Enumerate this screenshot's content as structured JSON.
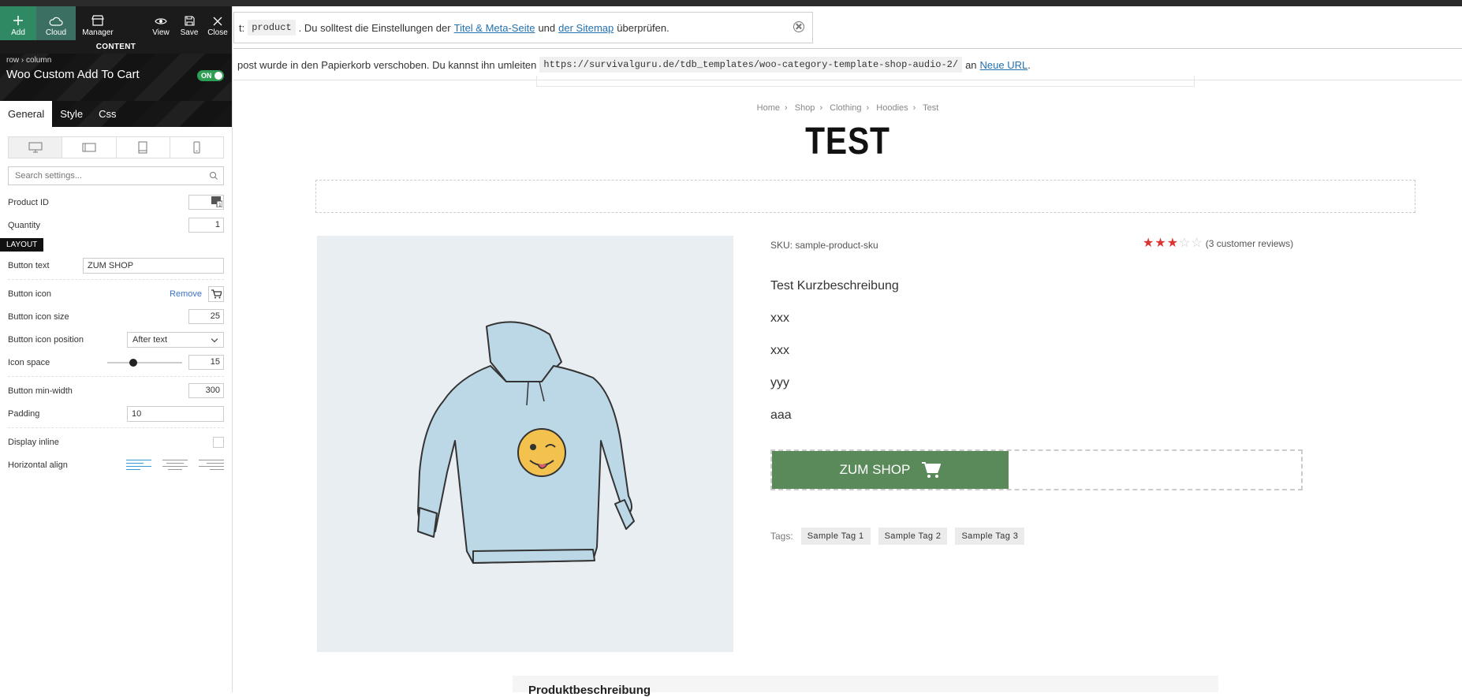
{
  "toolbar": {
    "add": "Add",
    "cloud": "Cloud",
    "manager": "Manager",
    "view": "View",
    "save": "Save",
    "close": "Close"
  },
  "panel": {
    "section": "CONTENT",
    "breadcrumb": [
      "row",
      "column"
    ],
    "element_title": "Woo Custom Add To Cart",
    "toggle": "ON",
    "tabs": [
      "General",
      "Style",
      "Css"
    ],
    "search_placeholder": "Search settings...",
    "product_id_label": "Product ID",
    "product_id_value": "",
    "quantity_label": "Quantity",
    "quantity_value": "1",
    "layout_badge": "LAYOUT",
    "button_text_label": "Button text",
    "button_text_value": "ZUM SHOP",
    "button_icon_label": "Button icon",
    "remove_label": "Remove",
    "icon_size_label": "Button icon size",
    "icon_size_value": "25",
    "icon_position_label": "Button icon position",
    "icon_position_value": "After text",
    "icon_space_label": "Icon space",
    "icon_space_value": "15",
    "icon_space_fraction": 0.33,
    "min_width_label": "Button min-width",
    "min_width_value": "300",
    "padding_label": "Padding",
    "padding_value": "10",
    "display_inline_label": "Display inline",
    "horizontal_align_label": "Horizontal align",
    "horizontal_align_selected": "left"
  },
  "notices": {
    "n1_prefix": "t:",
    "n1_code": "product",
    "n1_middle": ". Du solltest die Einstellungen der",
    "n1_link1": "Titel & Meta-Seite",
    "n1_and": "und",
    "n1_link2": "der Sitemap",
    "n1_suffix": "überprüfen.",
    "n2_prefix": "post wurde in den Papierkorb verschoben. Du kannst ihn umleiten",
    "n2_code": "https://survivalguru.de/tdb_templates/woo-category-template-shop-audio-2/",
    "n2_an": "an",
    "n2_link": "Neue URL",
    "n2_dot": "."
  },
  "page": {
    "breadcrumb": [
      "Home",
      "Shop",
      "Clothing",
      "Hoodies",
      "Test"
    ],
    "title": "TEST",
    "sku": "SKU: sample-product-sku",
    "rating_value": 3,
    "rating_max": 5,
    "reviews": "(3 customer reviews)",
    "short_description": [
      "Test Kurzbeschreibung",
      "xxx",
      "xxx",
      "yyy",
      "aaa"
    ],
    "cart_button": "ZUM SHOP",
    "tags_label": "Tags:",
    "tags": [
      "Sample Tag 1",
      "Sample Tag 2",
      "Sample Tag 3"
    ],
    "section_title": "Produktbeschreibung"
  },
  "colors": {
    "add_green": "#2f8a63",
    "cart_green": "#5a8a5a",
    "star_red": "#dd3333",
    "link_blue": "#2271b1"
  }
}
